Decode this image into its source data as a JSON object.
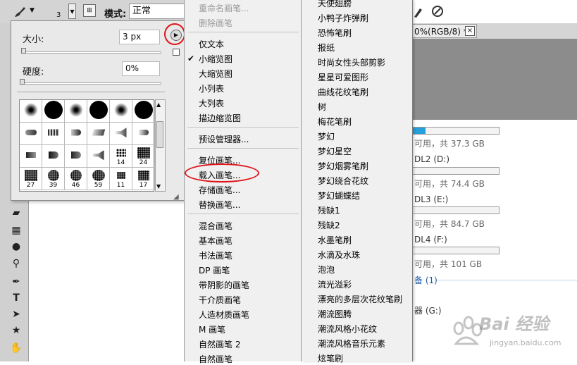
{
  "options_bar": {
    "brush_size_value": "3",
    "mode_label": "模式:",
    "mode_value": "正常"
  },
  "brush_panel": {
    "size_label": "大小:",
    "size_value": "3 px",
    "hardness_label": "硬度:",
    "hardness_value": "0%",
    "size_slider_fraction": 0.0,
    "hardness_slider_fraction": 0.0,
    "grid_numbers": [
      "14",
      "24",
      "27",
      "39",
      "46",
      "59",
      "11",
      "17"
    ]
  },
  "menu1": {
    "items_top_disabled": [
      "重命名画笔...",
      "删除画笔"
    ],
    "view_options": [
      "仅文本",
      "小缩览图",
      "大缩览图",
      "小列表",
      "大列表",
      "描边缩览图"
    ],
    "checked_view": "小缩览图",
    "preset_manager": "预设管理器...",
    "file_ops": [
      "复位画笔...",
      "载入画笔...",
      "存储画笔...",
      "替换画笔..."
    ],
    "libraries": [
      "混合画笔",
      "基本画笔",
      "书法画笔",
      "DP 画笔",
      "带阴影的画笔",
      "干介质画笔",
      "人造材质画笔",
      "M 画笔",
      "自然画笔 2",
      "自然画笔"
    ]
  },
  "menu2": {
    "items": [
      "天使翅膀",
      "小鸭子炸弹刷",
      "恐怖笔刷",
      "报纸",
      "时尚女性头部剪影",
      "星星可爱图形",
      "曲线花纹笔刷",
      "树",
      "梅花笔刷",
      "梦幻",
      "梦幻星空",
      "梦幻烟雾笔刷",
      "梦幻绕合花纹",
      "梦幻蝴蝶结",
      "残缺1",
      "残缺2",
      "水墨笔刷",
      "水滴及水珠",
      "泡泡",
      "流光溢彩",
      "漂亮的多层次花纹笔刷",
      "潮流图腾",
      "潮流风格小花纹",
      "潮流风格音乐元素",
      "炫笔刷"
    ]
  },
  "background_window": {
    "doc_tab": "0%(RGB/8) *",
    "doc_close": "×",
    "drives": [
      {
        "sub": "可用，共 37.3 GB",
        "fill": 0.15
      },
      {
        "name": "DL2 (D:)",
        "sub": "可用，共 74.4 GB",
        "fill": 0
      },
      {
        "name": "DL3 (E:)",
        "sub": "可用，共 84.7 GB",
        "fill": 0
      },
      {
        "name": "DL4 (F:)",
        "sub": "可用，共 101 GB",
        "fill": 0
      }
    ],
    "group_link": "备 (1)",
    "removable": "器 (G:)"
  },
  "watermark": {
    "text": "Bai 经验",
    "url": "jingyan.baidu.com"
  },
  "colors": {
    "highlight_red": "#e0151b",
    "drive_fill": "#26a0da"
  }
}
